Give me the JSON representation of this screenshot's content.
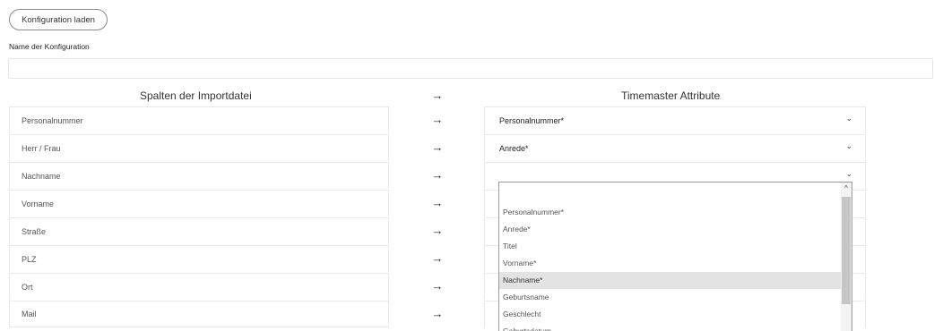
{
  "toolbar": {
    "load_button": "Konfiguration laden"
  },
  "config": {
    "name_label": "Name der Konfiguration",
    "name_value": ""
  },
  "headers": {
    "left": "Spalten der Importdatei",
    "arrow": "→",
    "right": "Timemaster Attribute"
  },
  "rows": [
    {
      "source": "Personalnummer",
      "arrow": "→",
      "target": "Personalnummer*"
    },
    {
      "source": "Herr / Frau",
      "arrow": "→",
      "target": "Anrede*"
    },
    {
      "source": "Nachname",
      "arrow": "→",
      "target": ""
    },
    {
      "source": "Vorname",
      "arrow": "→"
    },
    {
      "source": "Straße",
      "arrow": "→"
    },
    {
      "source": "PLZ",
      "arrow": "→"
    },
    {
      "source": "Ort",
      "arrow": "→"
    },
    {
      "source": "Mail",
      "arrow": "→"
    }
  ],
  "dropdown": {
    "options": [
      "Personalnummer*",
      "Anrede*",
      "Titel",
      "Vorname*",
      "Nachname*",
      "Geburtsname",
      "Geschlecht",
      "Geburtsdatum"
    ],
    "selected": "Nachname*"
  },
  "icons": {
    "chevron": "chevron-down-icon",
    "arrow": "arrow-right-icon",
    "scroll_up": "chevron-up-icon"
  },
  "colors": {
    "border": "#eaeaea",
    "selected_option": "#e3e3e3",
    "scroll_thumb": "#c6c6c6"
  }
}
